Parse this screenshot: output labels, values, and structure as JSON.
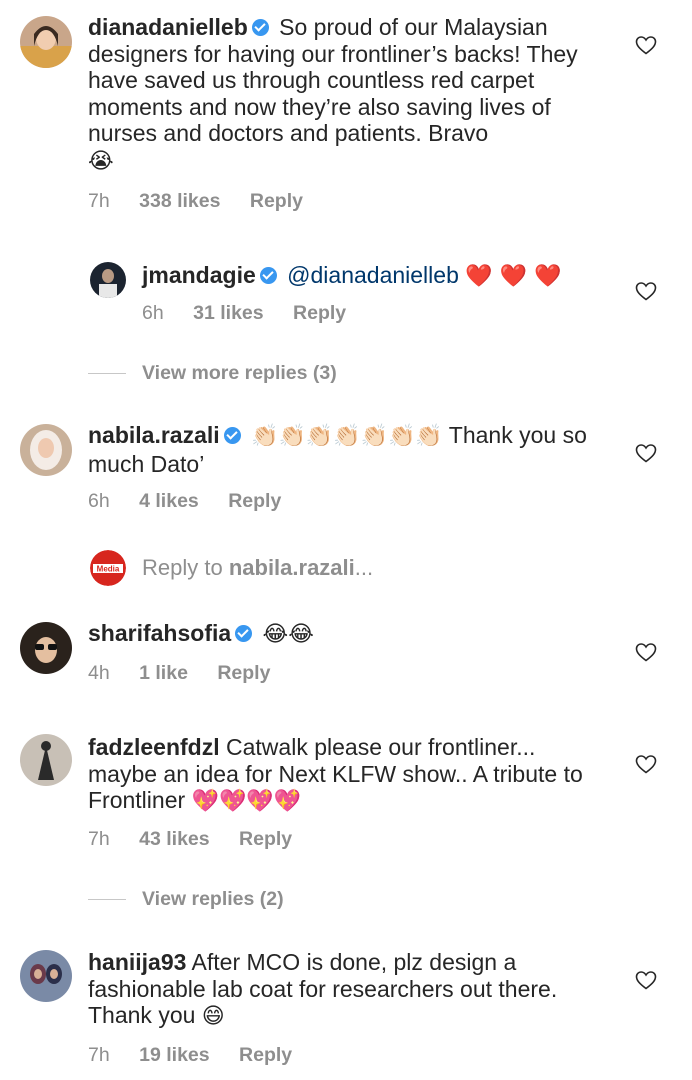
{
  "comments": [
    {
      "username": "dianadanielleb",
      "text": " So proud of our Malaysian designers for having our frontliner’s backs! They have saved us through countless red carpet moments and now they’re also saving lives of nurses and doctors and patients. Bravo",
      "emoji": "😭",
      "time": "7h",
      "likes": "338 likes",
      "reply": "Reply",
      "avatar_icon": "avatar-photo-woman"
    },
    {
      "username": "jmandagie",
      "mention": "@dianadanielleb",
      "emoji": "❤️ ❤️ ❤️",
      "time": "6h",
      "likes": "31 likes",
      "reply": "Reply",
      "avatar_icon": "avatar-photo-man"
    },
    {
      "username": "nabila.razali",
      "emoji": "👏🏻👏🏻👏🏻👏🏻👏🏻👏🏻👏🏻",
      "text": " Thank you so much Dato’",
      "time": "6h",
      "likes": "4 likes",
      "reply": "Reply",
      "avatar_icon": "avatar-photo-woman-hijab"
    },
    {
      "username": "sharifahsofia",
      "emoji": "😂😂",
      "time": "4h",
      "likes": "1 like",
      "reply": "Reply",
      "avatar_icon": "avatar-photo-woman-sunglasses"
    },
    {
      "username": "fadzleenfdzl",
      "text": " Catwalk please our frontliner... maybe an idea for Next KLFW show.. A tribute to Frontliner ",
      "emoji": "💖💖💖💖",
      "time": "7h",
      "likes": "43 likes",
      "reply": "Reply",
      "avatar_icon": "avatar-photo-figure"
    },
    {
      "username": "haniija93",
      "text": " After MCO is done,  plz design a fashionable lab coat for researchers out there. Thank you ",
      "emoji": "😄",
      "time": "7h",
      "likes": "19 likes",
      "reply": "Reply",
      "avatar_icon": "avatar-photo-group"
    }
  ],
  "view_more_replies_1": "View more replies (3)",
  "view_replies_2": "View replies (2)",
  "reply_to": {
    "prefix": "Reply to ",
    "username": "nabila.razali",
    "suffix": "..."
  },
  "media_logo_text": "Media",
  "colors": {
    "verified": "#3897f0",
    "muted": "#8e8e8e",
    "text": "#262626",
    "heart": "#ed4956"
  }
}
